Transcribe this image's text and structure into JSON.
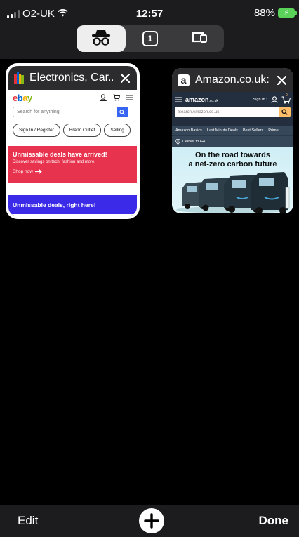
{
  "status_bar": {
    "carrier": "O2-UK",
    "time": "12:57",
    "battery": "88%"
  },
  "tab_mode_switcher": {
    "segments": [
      {
        "name": "incognito",
        "icon": "incognito-icon",
        "selected": true
      },
      {
        "name": "regular-tabs",
        "icon": "tab-count-icon",
        "count": "1",
        "selected": false
      },
      {
        "name": "recent-tabs",
        "icon": "devices-icon",
        "selected": false
      }
    ]
  },
  "tabs": [
    {
      "title": "Electronics, Car...",
      "favicon": "ebay-favicon",
      "selected": true,
      "preview": {
        "logo": "ebay",
        "search_placeholder": "Search for anything",
        "pills": [
          "Sign In / Register",
          "Brand Outlet",
          "Selling"
        ],
        "banner_heading": "Unmissable deals have arrived!",
        "banner_sub": "Discover savings on tech, fashion and more.",
        "banner_cta": "Shop now",
        "strip_text": "Unmissable deals, right here!"
      }
    },
    {
      "title": "Amazon.co.uk:...",
      "favicon": "amazon-favicon",
      "selected": false,
      "preview": {
        "logo": "amazon",
        "logo_suffix": ".co.uk",
        "signin": "Sign In ›",
        "cart_count": "0",
        "search_placeholder": "Search Amazon.co.uk",
        "nav_items": [
          "Amazon Basics",
          "Last Minute Deals",
          "Best Sellers",
          "Prime"
        ],
        "deliver_to": "Deliver to G41",
        "hero_line1": "On the road towards",
        "hero_line2": "a net-zero carbon future"
      }
    }
  ],
  "bottom_bar": {
    "edit_label": "Edit",
    "done_label": "Done"
  },
  "colors": {
    "ebay_banner": "#e8334e",
    "ebay_strip": "#3b2ae8",
    "ebay_blue": "#3665f3",
    "amazon_dark": "#232f3e",
    "amazon_orange": "#febd69",
    "battery_green": "#5ad25a"
  }
}
